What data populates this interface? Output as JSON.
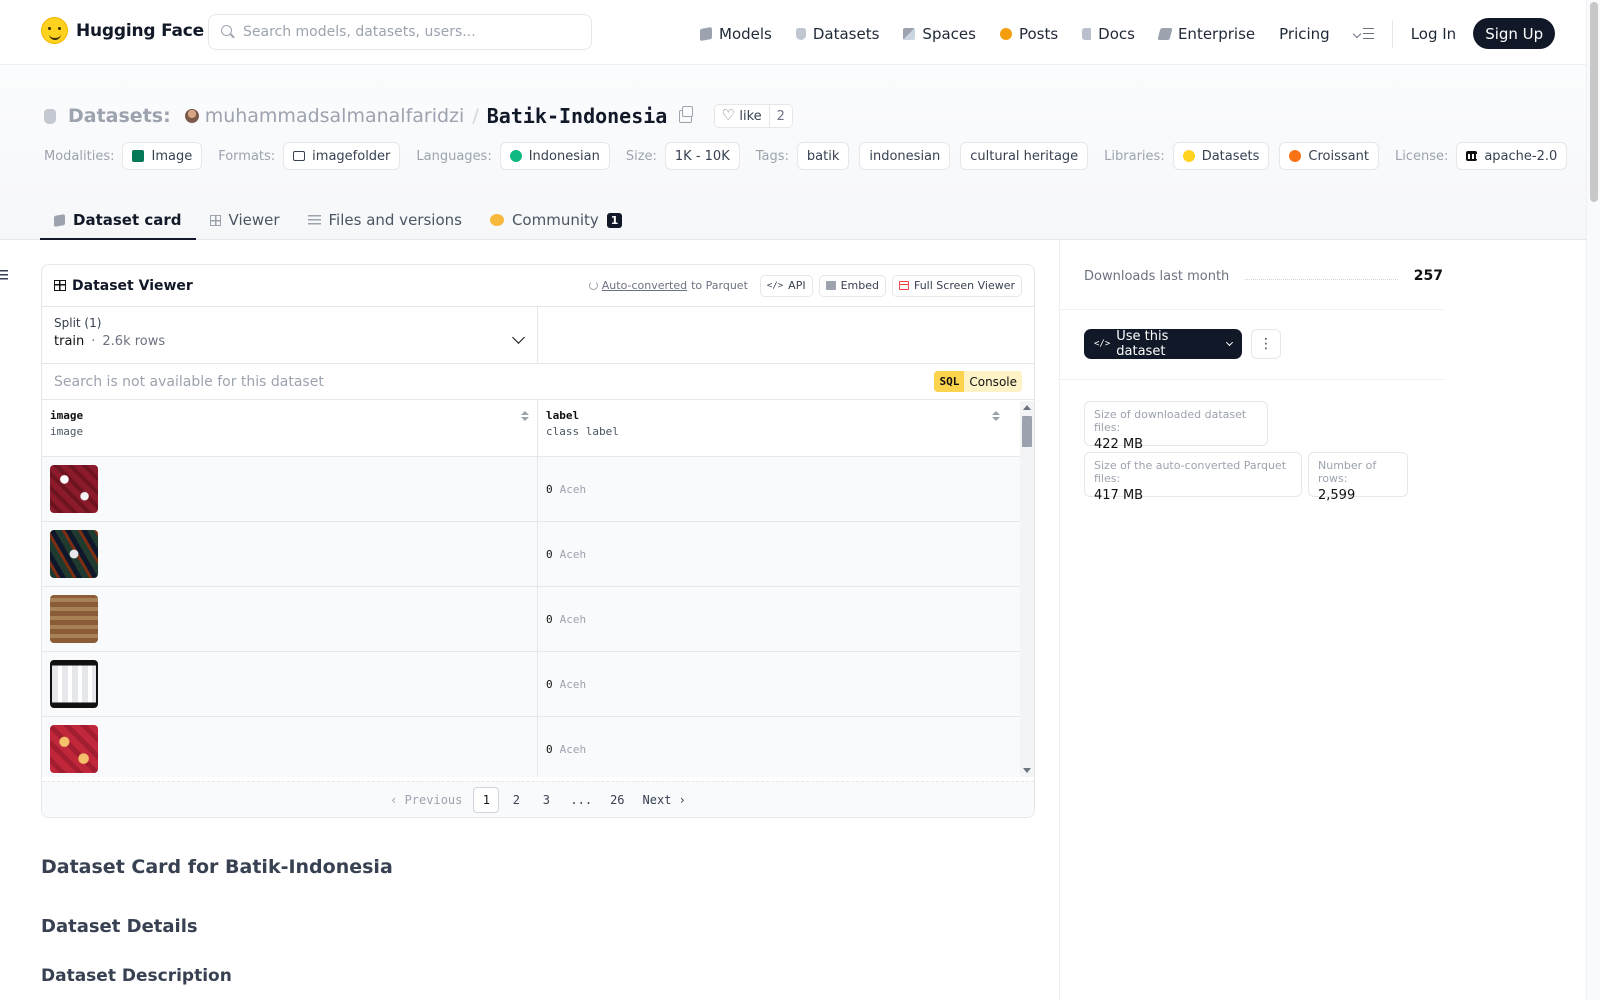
{
  "nav": {
    "brand": "Hugging Face",
    "search_placeholder": "Search models, datasets, users...",
    "links": [
      "Models",
      "Datasets",
      "Spaces",
      "Posts",
      "Docs",
      "Enterprise",
      "Pricing"
    ],
    "login": "Log In",
    "signup": "Sign Up"
  },
  "header": {
    "section": "Datasets:",
    "user": "muhammadsalmanalfaridzi",
    "name": "Batik-Indonesia",
    "like_label": "like",
    "like_count": "2",
    "meta": {
      "modalities_label": "Modalities:",
      "modality": "Image",
      "formats_label": "Formats:",
      "format": "imagefolder",
      "languages_label": "Languages:",
      "language": "Indonesian",
      "size_label": "Size:",
      "size": "1K - 10K",
      "tags_label": "Tags:",
      "tags": [
        "batik",
        "indonesian",
        "cultural heritage"
      ],
      "libraries_label": "Libraries:",
      "libraries": [
        "Datasets",
        "Croissant"
      ],
      "license_label": "License:",
      "license": "apache-2.0"
    }
  },
  "tabs": [
    {
      "label": "Dataset card"
    },
    {
      "label": "Viewer"
    },
    {
      "label": "Files and versions"
    },
    {
      "label": "Community",
      "badge": "1"
    }
  ],
  "viewer": {
    "title": "Dataset Viewer",
    "converted_link": "Auto-converted",
    "converted_rest": "to Parquet",
    "api": "API",
    "embed": "Embed",
    "fullscreen": "Full Screen Viewer",
    "split_label": "Split (1)",
    "split_value": "train",
    "split_dot": "·",
    "split_rows": "2.6k rows",
    "search_msg": "Search is not available for this dataset",
    "sql_label": "SQL",
    "console_label": "Console",
    "columns": [
      {
        "name": "image",
        "type": "image"
      },
      {
        "name": "label",
        "type": "class label"
      }
    ],
    "rows": [
      {
        "label_id": "0",
        "label_name": "Aceh"
      },
      {
        "label_id": "0",
        "label_name": "Aceh"
      },
      {
        "label_id": "0",
        "label_name": "Aceh"
      },
      {
        "label_id": "0",
        "label_name": "Aceh"
      },
      {
        "label_id": "0",
        "label_name": "Aceh"
      }
    ],
    "pager": {
      "prev": "Previous",
      "pages": [
        "1",
        "2",
        "3",
        "...",
        "26"
      ],
      "next": "Next",
      "current": "1"
    }
  },
  "card": {
    "heading": "Dataset Card for Batik-Indonesia",
    "details": "Dataset Details",
    "description": "Dataset Description"
  },
  "sidebar": {
    "downloads_label": "Downloads last month",
    "downloads_value": "257",
    "use_button": "Use this dataset",
    "stats": [
      {
        "label": "Size of downloaded dataset files:",
        "value": "422 MB"
      },
      {
        "label": "Size of the auto-converted Parquet files:",
        "value": "417 MB"
      },
      {
        "label": "Number of rows:",
        "value": "2,599"
      }
    ]
  }
}
